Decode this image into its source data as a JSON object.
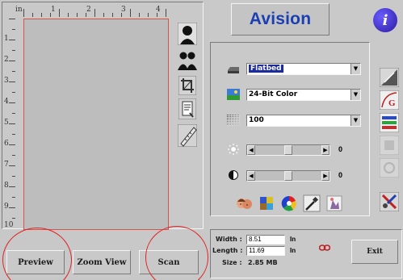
{
  "preview": {
    "ruler_top_labels": [
      "in",
      "1",
      "2",
      "3",
      "4"
    ],
    "ruler_left_labels": [
      "1",
      "2",
      "3",
      "4",
      "5",
      "6",
      "7",
      "8",
      "9",
      "10"
    ],
    "tools": [
      {
        "name": "person-silhouette-icon"
      },
      {
        "name": "multi-person-icon"
      },
      {
        "name": "crop-icon"
      },
      {
        "name": "document-icon"
      },
      {
        "name": "ruler-icon"
      }
    ]
  },
  "buttons": {
    "preview": "Preview",
    "zoom_view": "Zoom View",
    "scan": "Scan",
    "exit": "Exit"
  },
  "brand": {
    "name": "Avision",
    "info": "i"
  },
  "settings": {
    "scan_source": "Flatbed",
    "color_mode": "24-Bit Color",
    "resolution": "100",
    "brightness_value": "0",
    "contrast_value": "0"
  },
  "dimensions": {
    "width_label": "Width :",
    "width_value": "8.51",
    "width_unit": "In",
    "length_label": "Length :",
    "length_value": "11.69",
    "length_unit": "In",
    "size_label": "Size :",
    "size_value": "2.85  MB"
  },
  "colors": {
    "accent": "#1a3fb2",
    "highlight_circle": "#e02020",
    "selected_item": "#1b2b9a"
  }
}
